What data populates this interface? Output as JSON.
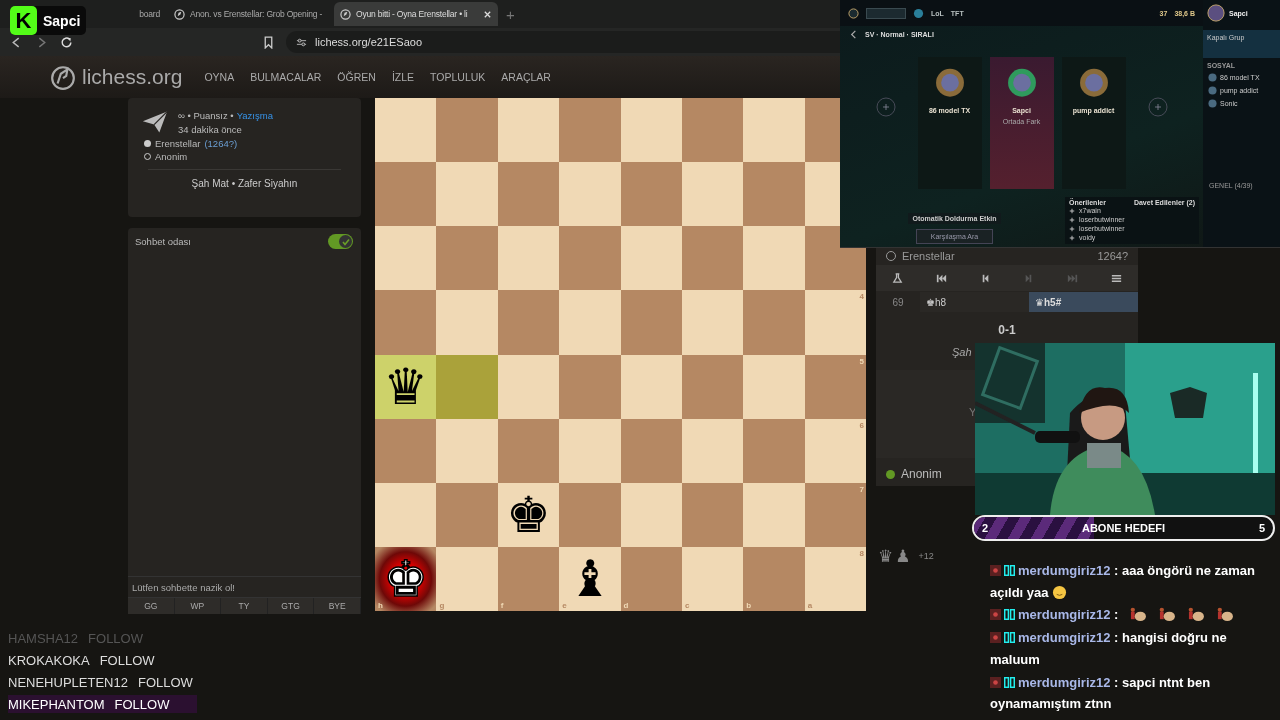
{
  "stream_logo": {
    "mark": "K",
    "name": "Sapci"
  },
  "browser": {
    "tabs": [
      {
        "title": "board",
        "favicon": false,
        "selected": false
      },
      {
        "title": "Anon. vs Erenstellar: Grob Opening -",
        "favicon": true,
        "selected": false
      },
      {
        "title": "Oyun bitti - Oyna Erenstellar • li",
        "favicon": true,
        "selected": true
      }
    ],
    "new_tab": "+",
    "url": "lichess.org/e21ESaoo"
  },
  "site": {
    "logo": "lichess.org",
    "nav": [
      "OYNA",
      "BULMACALAR",
      "ÖĞREN",
      "İZLE",
      "TOPLULUK",
      "ARAÇLAR"
    ]
  },
  "game_info": {
    "speed_line": "∞ • Puansız •",
    "mode": "Yazışma",
    "time": "34 dakika önce",
    "players": [
      {
        "name": "Erenstellar",
        "rating": "(1264?)",
        "white": true
      },
      {
        "name": "Anonim",
        "white": false
      }
    ],
    "result": "Şah Mat • Zafer Siyahın"
  },
  "chat": {
    "title": "Sohbet odası",
    "enabled": true,
    "placeholder": "Lütfen sohbette nazik ol!",
    "presets": [
      "GG",
      "WP",
      "TY",
      "GTG",
      "BYE"
    ]
  },
  "board": {
    "files": [
      "h",
      "g",
      "f",
      "e",
      "d",
      "c",
      "b",
      "a"
    ],
    "rows": [
      {
        "cells": [
          {
            "highlight": false,
            "check": false
          },
          {
            "highlight": false,
            "check": false
          },
          {
            "highlight": false,
            "check": false
          },
          {
            "highlight": false,
            "check": false
          },
          {
            "highlight": false,
            "check": false
          },
          {
            "highlight": false,
            "check": false
          },
          {
            "highlight": false,
            "check": false
          },
          {
            "highlight": false,
            "check": false
          }
        ]
      },
      {
        "cells": [
          {
            "highlight": false,
            "check": false
          },
          {
            "highlight": false,
            "check": false
          },
          {
            "highlight": false,
            "check": false
          },
          {
            "highlight": false,
            "check": false
          },
          {
            "highlight": false,
            "check": false
          },
          {
            "highlight": false,
            "check": false
          },
          {
            "highlight": false,
            "check": false
          },
          {
            "highlight": false,
            "check": false
          }
        ]
      },
      {
        "cells": [
          {
            "highlight": false,
            "check": false
          },
          {
            "highlight": false,
            "check": false
          },
          {
            "highlight": false,
            "check": false
          },
          {
            "highlight": false,
            "check": false
          },
          {
            "highlight": false,
            "check": false
          },
          {
            "highlight": false,
            "check": false
          },
          {
            "highlight": false,
            "check": false
          },
          {
            "highlight": false,
            "check": false
          }
        ]
      },
      {
        "rank_label": "4",
        "cells": [
          {
            "highlight": false,
            "check": false
          },
          {
            "highlight": false,
            "check": false
          },
          {
            "highlight": false,
            "check": false
          },
          {
            "highlight": false,
            "check": false
          },
          {
            "highlight": false,
            "check": false
          },
          {
            "highlight": false,
            "check": false
          },
          {
            "highlight": false,
            "check": false
          },
          {
            "highlight": false,
            "check": false
          }
        ]
      },
      {
        "rank_label": "5",
        "cells": [
          {
            "highlight": true,
            "check": false,
            "piece": {
              "glyph": "♛",
              "white": false
            }
          },
          {
            "highlight": true,
            "check": false
          },
          {
            "highlight": false,
            "check": false
          },
          {
            "highlight": false,
            "check": false
          },
          {
            "highlight": false,
            "check": false
          },
          {
            "highlight": false,
            "check": false
          },
          {
            "highlight": false,
            "check": false
          },
          {
            "highlight": false,
            "check": false
          }
        ]
      },
      {
        "rank_label": "6",
        "cells": [
          {
            "highlight": false,
            "check": false
          },
          {
            "highlight": false,
            "check": false
          },
          {
            "highlight": false,
            "check": false
          },
          {
            "highlight": false,
            "check": false
          },
          {
            "highlight": false,
            "check": false
          },
          {
            "highlight": false,
            "check": false
          },
          {
            "highlight": false,
            "check": false
          },
          {
            "highlight": false,
            "check": false
          }
        ]
      },
      {
        "rank_label": "7",
        "cells": [
          {
            "highlight": false,
            "check": false
          },
          {
            "highlight": false,
            "check": false
          },
          {
            "highlight": false,
            "check": false,
            "piece": {
              "glyph": "♚",
              "white": false
            }
          },
          {
            "highlight": false,
            "check": false
          },
          {
            "highlight": false,
            "check": false
          },
          {
            "highlight": false,
            "check": false
          },
          {
            "highlight": false,
            "check": false
          },
          {
            "highlight": false,
            "check": false
          }
        ]
      },
      {
        "rank_label": "8",
        "cells": [
          {
            "highlight": false,
            "check": true,
            "piece": {
              "glyph": "♚",
              "white": true
            }
          },
          {
            "highlight": false,
            "check": false
          },
          {
            "highlight": false,
            "check": false
          },
          {
            "highlight": false,
            "check": false,
            "piece": {
              "glyph": "♝",
              "white": false
            }
          },
          {
            "highlight": false,
            "check": false
          },
          {
            "highlight": false,
            "check": false
          },
          {
            "highlight": false,
            "check": false
          },
          {
            "highlight": false,
            "check": false
          }
        ]
      }
    ]
  },
  "move_panel": {
    "top_player": {
      "name": "Erenstellar",
      "rating": "1264?"
    },
    "nav_buttons": [
      {
        "kind": "analysis",
        "disabled": false
      },
      {
        "kind": "first",
        "disabled": false
      },
      {
        "kind": "prev",
        "disabled": false
      },
      {
        "kind": "next",
        "disabled": true
      },
      {
        "kind": "last",
        "disabled": true
      },
      {
        "kind": "menu",
        "disabled": false
      }
    ],
    "move_number": "69",
    "moves": [
      {
        "san": "♚h8",
        "selected": false
      },
      {
        "san": "♛h5#",
        "selected": true
      }
    ],
    "score": "0-1",
    "status": "Şah",
    "cut_text": "Y",
    "bottom_player": {
      "name": "Anonim",
      "online": true
    }
  },
  "material": {
    "pieces": [
      "♛",
      "♟"
    ],
    "score": "+12"
  },
  "lol_client": {
    "nav": [
      "LoL",
      "TFT"
    ],
    "currency": [
      "37",
      "38,6 B"
    ],
    "profile": "Sapci",
    "lobby": "SV · Normal · SIRALI",
    "members": [
      {
        "name": "86 model TX",
        "selected": false
      },
      {
        "name": "Sapci",
        "subtitle": "Ortada Fark",
        "selected": true
      },
      {
        "name": "pump addict",
        "selected": false
      }
    ],
    "autofill": "Otomatik Doldurma Etkin",
    "find_match": "Karşılaşma Ara",
    "invite_tabs": [
      "Önerilenler",
      "Davet Edilenler (2)"
    ],
    "invites": [
      "x7wain",
      "loserbutwinner",
      "loserbutwinner",
      "voidy"
    ],
    "group": "Kapalı Grup",
    "social_title": "SOSYAL",
    "friends": [
      "86 model TX",
      "pump addict",
      "Sonic"
    ],
    "section": "GENEL (4/39)"
  },
  "sub_goal": {
    "current": "2",
    "title": "ABONE HEDEFI",
    "target": "5",
    "level": 0.4
  },
  "stream_chat": [
    {
      "user": "merdumgiriz12",
      "text": ": aaa öngörü ne zaman açıldı yaa",
      "emotes": [
        {
          "kind": "smiley"
        }
      ]
    },
    {
      "user": "merdumgiriz12",
      "text": ":",
      "emotes": [
        {
          "kind": "drummer"
        },
        {
          "kind": "drummer"
        },
        {
          "kind": "drummer"
        },
        {
          "kind": "drummer"
        }
      ]
    },
    {
      "user": "merdumgiriz12",
      "text": ": hangisi doğru ne maluum"
    },
    {
      "user": "merdumgiriz12",
      "text": ": sapci ntnt ben oynamamıştım ztnn"
    }
  ],
  "follows": [
    {
      "name": "HAMSHA12",
      "action": "FOLLOW",
      "faded": true,
      "highlighted": false
    },
    {
      "name": "KROKAKOKA",
      "action": "FOLLOW",
      "faded": false,
      "highlighted": false
    },
    {
      "name": "NENEHUPLETEN12",
      "action": "FOLLOW",
      "faded": false,
      "highlighted": false
    },
    {
      "name": "MIKEPHANTOM",
      "action": "FOLLOW",
      "faded": false,
      "highlighted": true
    }
  ]
}
